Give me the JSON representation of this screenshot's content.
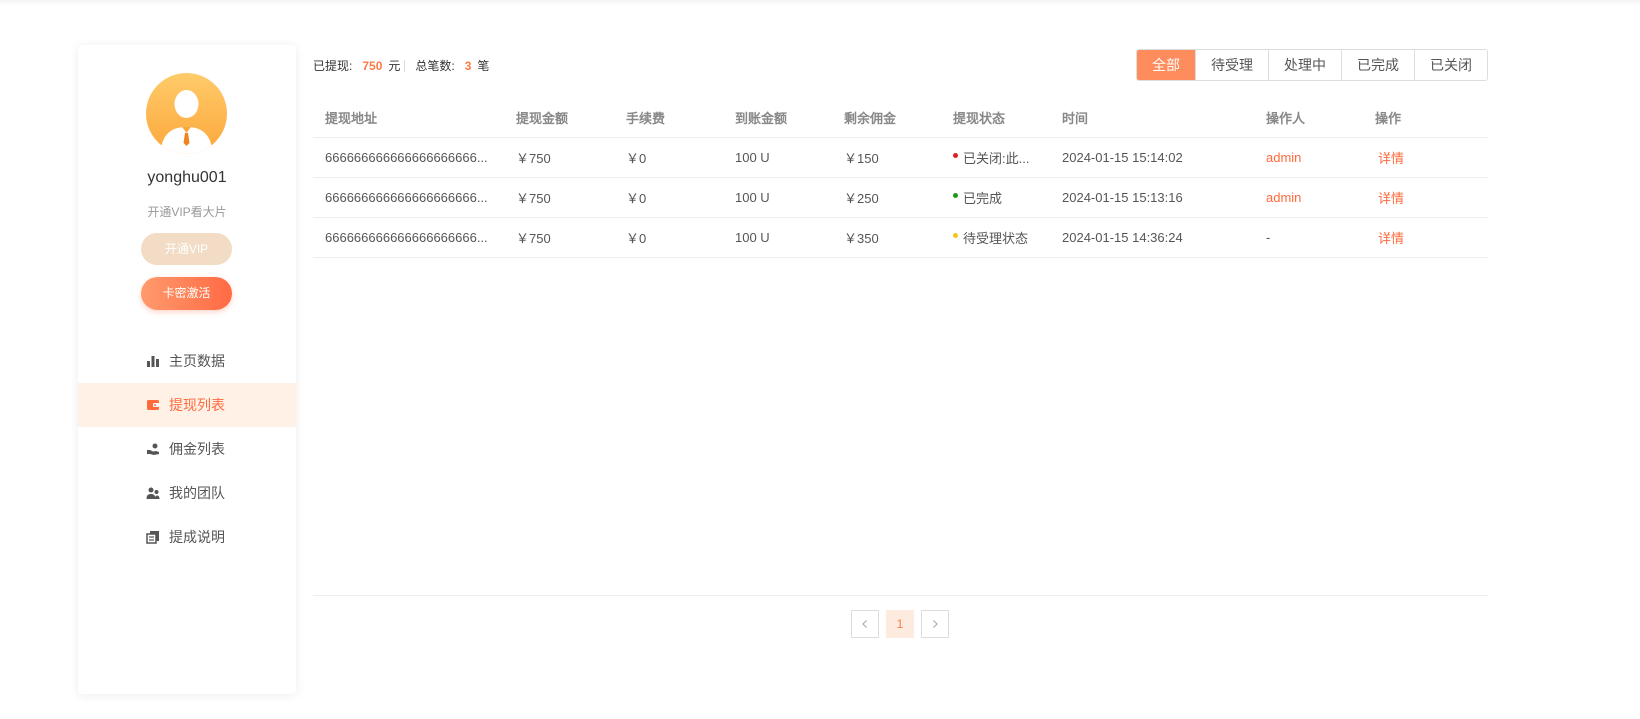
{
  "user": {
    "name": "yonghu001",
    "slogan": "开通VIP看大片",
    "vip_button": "开通VIP",
    "card_button": "卡密激活"
  },
  "menu": [
    {
      "label": "主页数据",
      "icon": "bar-chart-icon"
    },
    {
      "label": "提现列表",
      "icon": "wallet-icon",
      "active": true
    },
    {
      "label": "佣金列表",
      "icon": "hand-coin-icon"
    },
    {
      "label": "我的团队",
      "icon": "team-icon"
    },
    {
      "label": "提成说明",
      "icon": "document-icon"
    }
  ],
  "summary": {
    "withdrawn_label": "已提现:",
    "withdrawn_value": "750",
    "withdrawn_unit": "元",
    "count_label": "总笔数:",
    "count_value": "3",
    "count_unit": "笔"
  },
  "filters": [
    "全部",
    "待受理",
    "处理中",
    "已完成",
    "已关闭"
  ],
  "table": {
    "headers": [
      "提现地址",
      "提现金额",
      "手续费",
      "到账金额",
      "剩余佣金",
      "提现状态",
      "时间",
      "操作人",
      "操作"
    ],
    "rows": [
      {
        "address": "666666666666666666666...",
        "amount": "￥750",
        "fee": "￥0",
        "received": "100 U",
        "remaining": "￥150",
        "status": "已关闭:此...",
        "status_color": "#e02020",
        "time": "2024-01-15 15:14:02",
        "operator": "admin",
        "action": "详情"
      },
      {
        "address": "666666666666666666666...",
        "amount": "￥750",
        "fee": "￥0",
        "received": "100 U",
        "remaining": "￥250",
        "status": "已完成",
        "status_color": "#1a9a1a",
        "time": "2024-01-15 15:13:16",
        "operator": "admin",
        "action": "详情"
      },
      {
        "address": "666666666666666666666...",
        "amount": "￥750",
        "fee": "￥0",
        "received": "100 U",
        "remaining": "￥350",
        "status": "待受理状态",
        "status_color": "#f5c518",
        "time": "2024-01-15 14:36:24",
        "operator": "-",
        "action": "详情"
      }
    ]
  },
  "pagination": {
    "current": "1"
  },
  "colors": {
    "accent": "#ff6a3d",
    "active_filter": "#ff8c5c",
    "active_menu_bg": "#fff1e6"
  }
}
